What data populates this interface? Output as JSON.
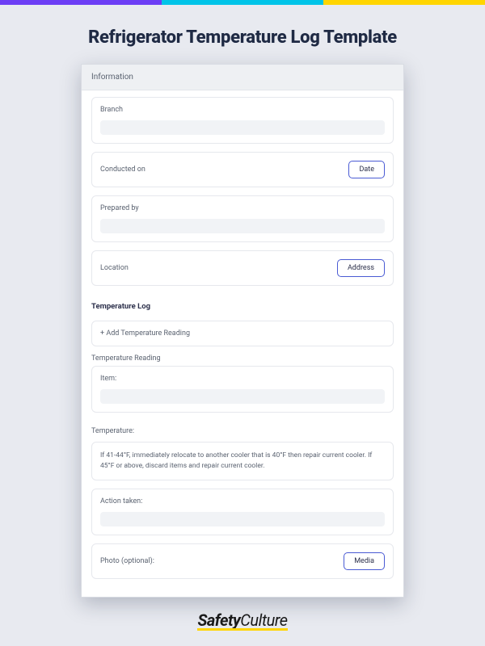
{
  "page_title": "Refrigerator Temperature Log Template",
  "form": {
    "section_information": "Information",
    "branch_label": "Branch",
    "conducted_on_label": "Conducted on",
    "date_button": "Date",
    "prepared_by_label": "Prepared by",
    "location_label": "Location",
    "address_button": "Address",
    "temp_log_heading": "Temperature Log",
    "add_reading": "+ Add Temperature Reading",
    "reading_section": "Temperature Reading",
    "item_label": "Item:",
    "temperature_label": "Temperature:",
    "temperature_note": "If 41-44°F, immediately relocate to another cooler that is 40°F then repair current cooler. If 45°F or above, discard items and repair current cooler.",
    "action_taken_label": "Action taken:",
    "photo_label": "Photo (optional):",
    "media_button": "Media"
  },
  "footer": {
    "brand_bold": "Safety",
    "brand_thin": "Culture"
  }
}
